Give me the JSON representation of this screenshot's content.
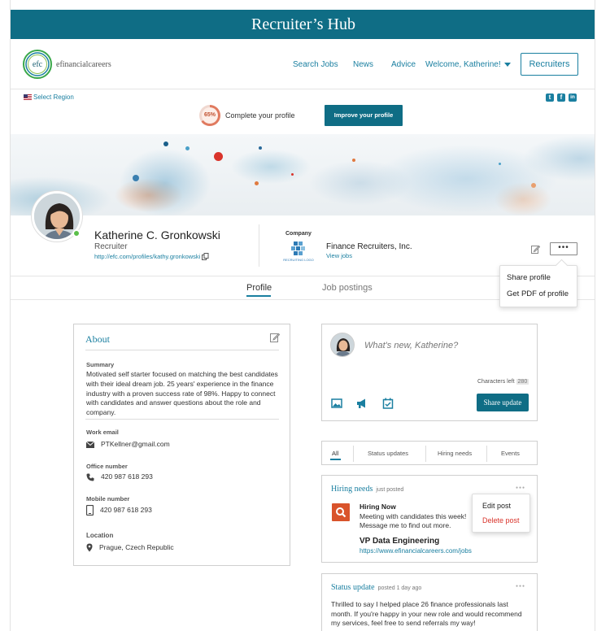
{
  "hub_title": "Recruiter’s Hub",
  "nav": {
    "logo_text": "efinancialcareers",
    "logo_mark": "efc",
    "links": [
      "Search Jobs",
      "News",
      "Advice",
      "Welcome, Katherine!"
    ],
    "recruiters_label": "Recruiters"
  },
  "region": {
    "label": "Select Region"
  },
  "social": [
    "t",
    "f",
    "in"
  ],
  "completion": {
    "percent_label": "65%",
    "percent": 65,
    "text": "Complete your profile",
    "button": "Improve your profile"
  },
  "profile": {
    "name": "Katherine C. Gronkowski",
    "role": "Recruiter",
    "url": "http://efc.com/profiles/kathy.gronkowski",
    "company_label": "Company",
    "company_name": "Finance Recruiters, Inc.",
    "view_jobs": "View jobs",
    "company_logo_text": "RECRUITING LOGO",
    "more_label": "•••"
  },
  "tabs": [
    "Profile",
    "Job postings"
  ],
  "share_menu": [
    "Share profile",
    "Get PDF of profile"
  ],
  "about": {
    "title": "About",
    "summary_label": "Summary",
    "summary": "Motivated self starter focused on matching the best candidates with their ideal dream job. 25 years' experience in the finance industry with a proven success rate of 98%. Happy to connect with candidates and answer questions about the role and company.",
    "email_label": "Work email",
    "email": "PTKellner@gmail.com",
    "office_label": "Office number",
    "office": "420 987 618 293",
    "mobile_label": "Mobile number",
    "mobile": "420 987 618 293",
    "location_label": "Location",
    "location": "Prague, Czech Republic"
  },
  "composer": {
    "placeholder": "What's new, Katherine?",
    "chars_left_label": "Characters left",
    "chars_left": "280",
    "share_button": "Share update"
  },
  "filters": [
    "All",
    "Status updates",
    "Hiring needs",
    "Events"
  ],
  "post_hiring": {
    "type": "Hiring needs",
    "time": "just posted",
    "title": "Hiring Now",
    "text": "Meeting with candidates this week! Message me to find out more.",
    "job_title": "VP Data Engineering",
    "job_link": "https://www.efinancialcareers.com/jobs"
  },
  "post_menu": [
    "Edit post",
    "Delete post"
  ],
  "post_status": {
    "type": "Status update",
    "time": "posted 1 day ago",
    "text": "Thrilled to say I helped place 26 finance professionals last month. If you're happy in your new role and would recommend my services, feel free to send referrals my way!"
  },
  "colors": {
    "brand": "#0f6d85",
    "link": "#1a7fa0",
    "danger": "#d9342b",
    "online": "#5bbf4a"
  }
}
